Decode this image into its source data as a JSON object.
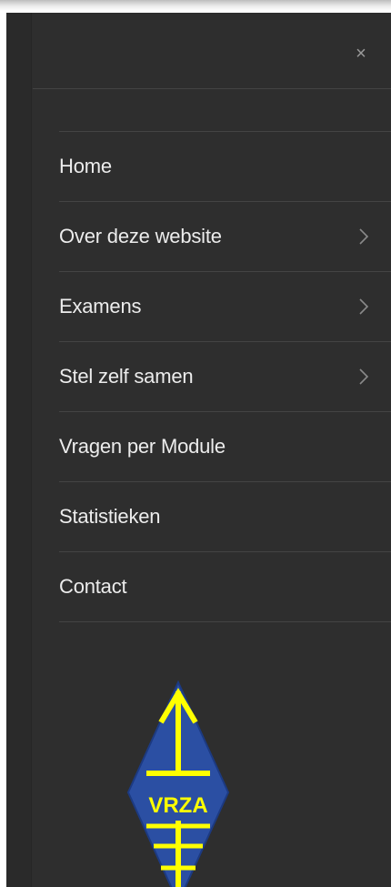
{
  "close_label": "×",
  "menu": {
    "items": [
      {
        "label": "Home",
        "has_submenu": false
      },
      {
        "label": "Over deze website",
        "has_submenu": true
      },
      {
        "label": "Examens",
        "has_submenu": true
      },
      {
        "label": "Stel zelf samen",
        "has_submenu": true
      },
      {
        "label": "Vragen per Module",
        "has_submenu": false
      },
      {
        "label": "Statistieken",
        "has_submenu": false
      },
      {
        "label": "Contact",
        "has_submenu": false
      }
    ]
  },
  "logo": {
    "text": "VRZA",
    "colors": {
      "background": "#2b4fa3",
      "symbol": "#ffff00"
    }
  },
  "colors": {
    "panel": "#2e2e2e",
    "divider": "#444444",
    "text": "#ececec",
    "chevron": "#8a8a8a"
  },
  "icons": {
    "close": "close-icon",
    "submenu": "chevron-right-icon"
  }
}
